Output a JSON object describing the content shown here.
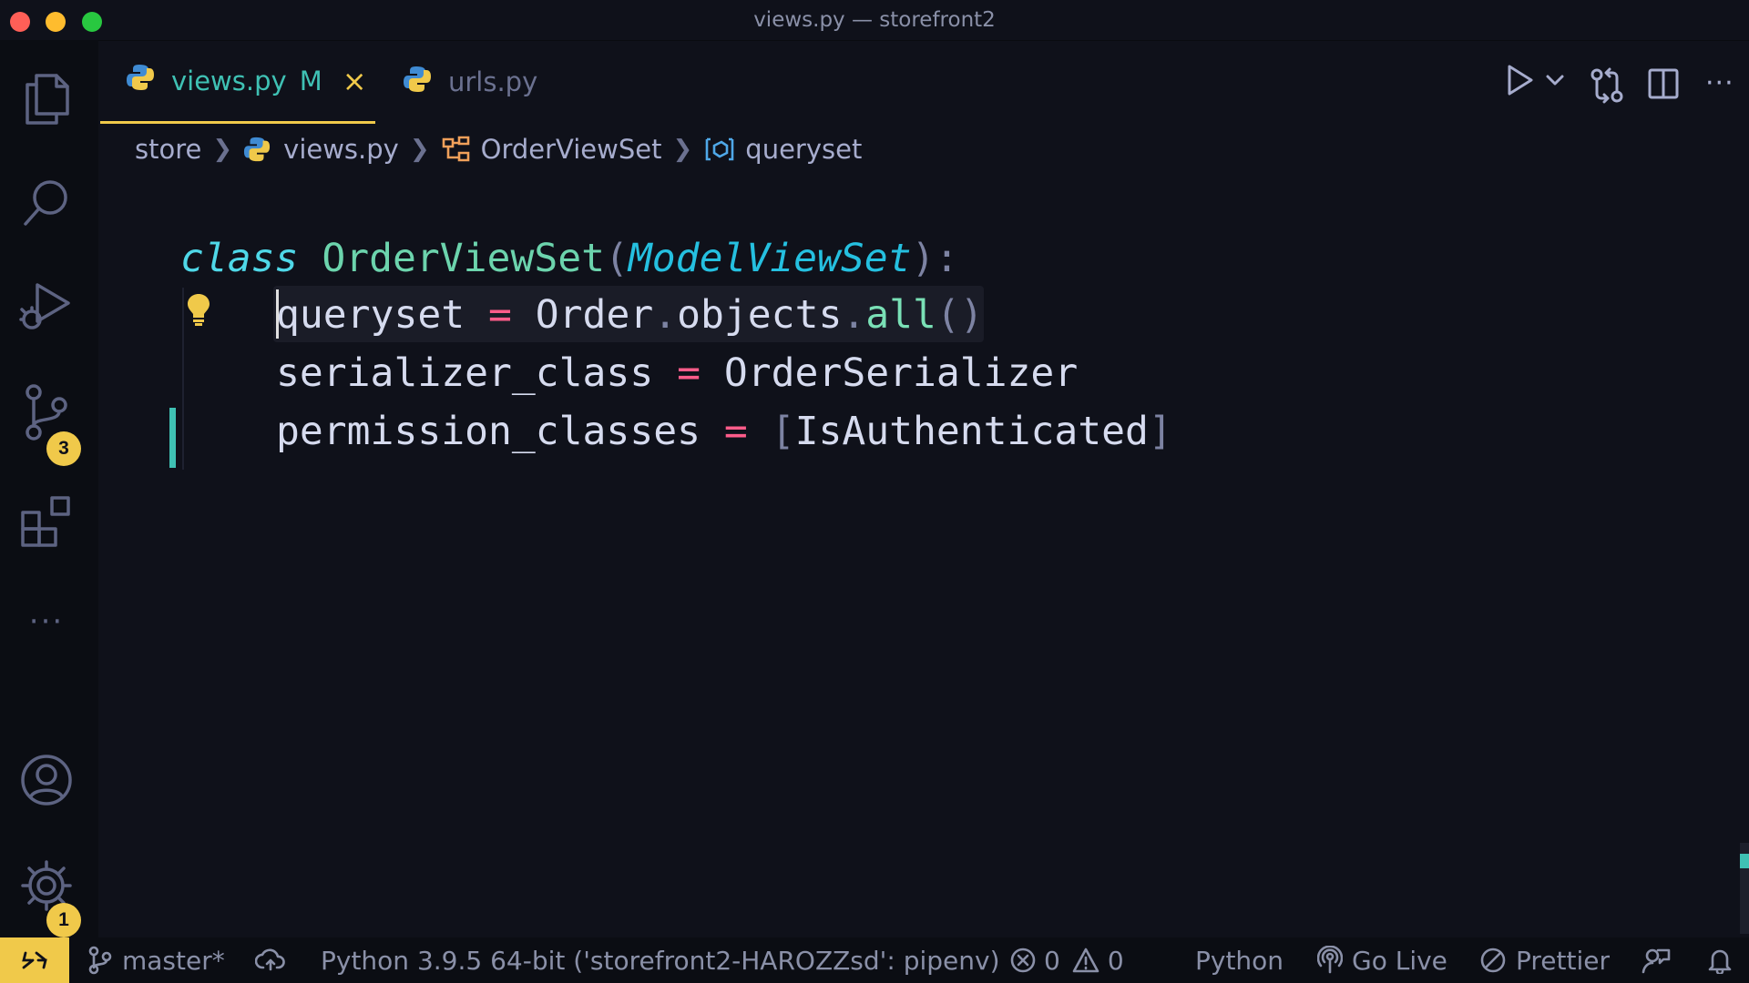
{
  "window": {
    "title": "views.py — storefront2"
  },
  "tabs": [
    {
      "label": "views.py",
      "modified": "M",
      "close": "×"
    },
    {
      "label": "urls.py"
    }
  ],
  "breadcrumb": [
    "store",
    "views.py",
    "OrderViewSet",
    "queryset"
  ],
  "code": {
    "line1": {
      "keyword": "class",
      "name": "OrderViewSet",
      "open": "(",
      "base": "ModelViewSet",
      "close": "):"
    },
    "line2": {
      "var": "queryset",
      "eq": "=",
      "obj": "Order",
      "dot1": ".",
      "attr": "objects",
      "dot2": ".",
      "fn": "all",
      "parens": "()"
    },
    "line3": {
      "var": "serializer_class",
      "eq": "=",
      "value": "OrderSerializer"
    },
    "line4": {
      "var": "permission_classes",
      "eq": "=",
      "lb": "[",
      "value": "IsAuthenticated",
      "rb": "]"
    }
  },
  "activity": {
    "source_control_badge": "3",
    "settings_badge": "1",
    "more": "···"
  },
  "status": {
    "branch": "master*",
    "interpreter": "Python 3.9.5 64-bit ('storefront2-HAROZZsd': pipenv)",
    "errors": "0",
    "warnings": "0",
    "language": "Python",
    "golive": "Go Live",
    "prettier": "Prettier"
  },
  "colors": {
    "accent": "#f0c94a",
    "teal": "#3fc1b4",
    "background": "#0f111a"
  }
}
